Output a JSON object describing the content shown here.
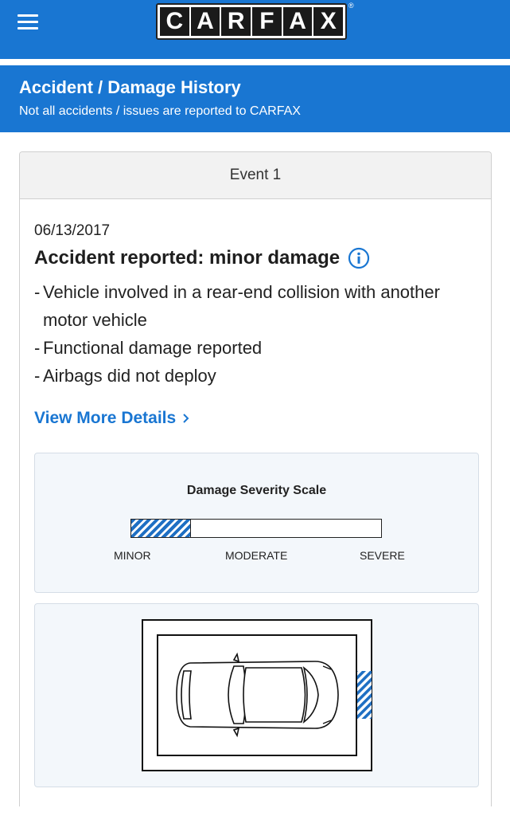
{
  "header": {
    "menu_icon": "hamburger-menu-icon",
    "logo_letters": [
      "C",
      "A",
      "R",
      "F",
      "A",
      "X"
    ],
    "logo_reg": "®",
    "brand_color": "#1976d2"
  },
  "section": {
    "title": "Accident / Damage History",
    "subtitle": "Not all accidents / issues are reported to CARFAX"
  },
  "event": {
    "heading": "Event 1",
    "date": "06/13/2017",
    "title": "Accident reported: minor damage",
    "info_icon": "info-icon",
    "bullets": [
      "Vehicle involved in a rear-end collision with another motor vehicle",
      "Functional damage reported",
      "Airbags did not deploy"
    ],
    "more_link": "View More Details"
  },
  "severity": {
    "title": "Damage Severity Scale",
    "labels": [
      "MINOR",
      "MODERATE",
      "SEVERE"
    ],
    "level": 0.24,
    "fill_color": "#1e6fc3"
  },
  "diagram": {
    "damage_location": "rear",
    "vehicle_icon": "car-top-view-icon"
  }
}
